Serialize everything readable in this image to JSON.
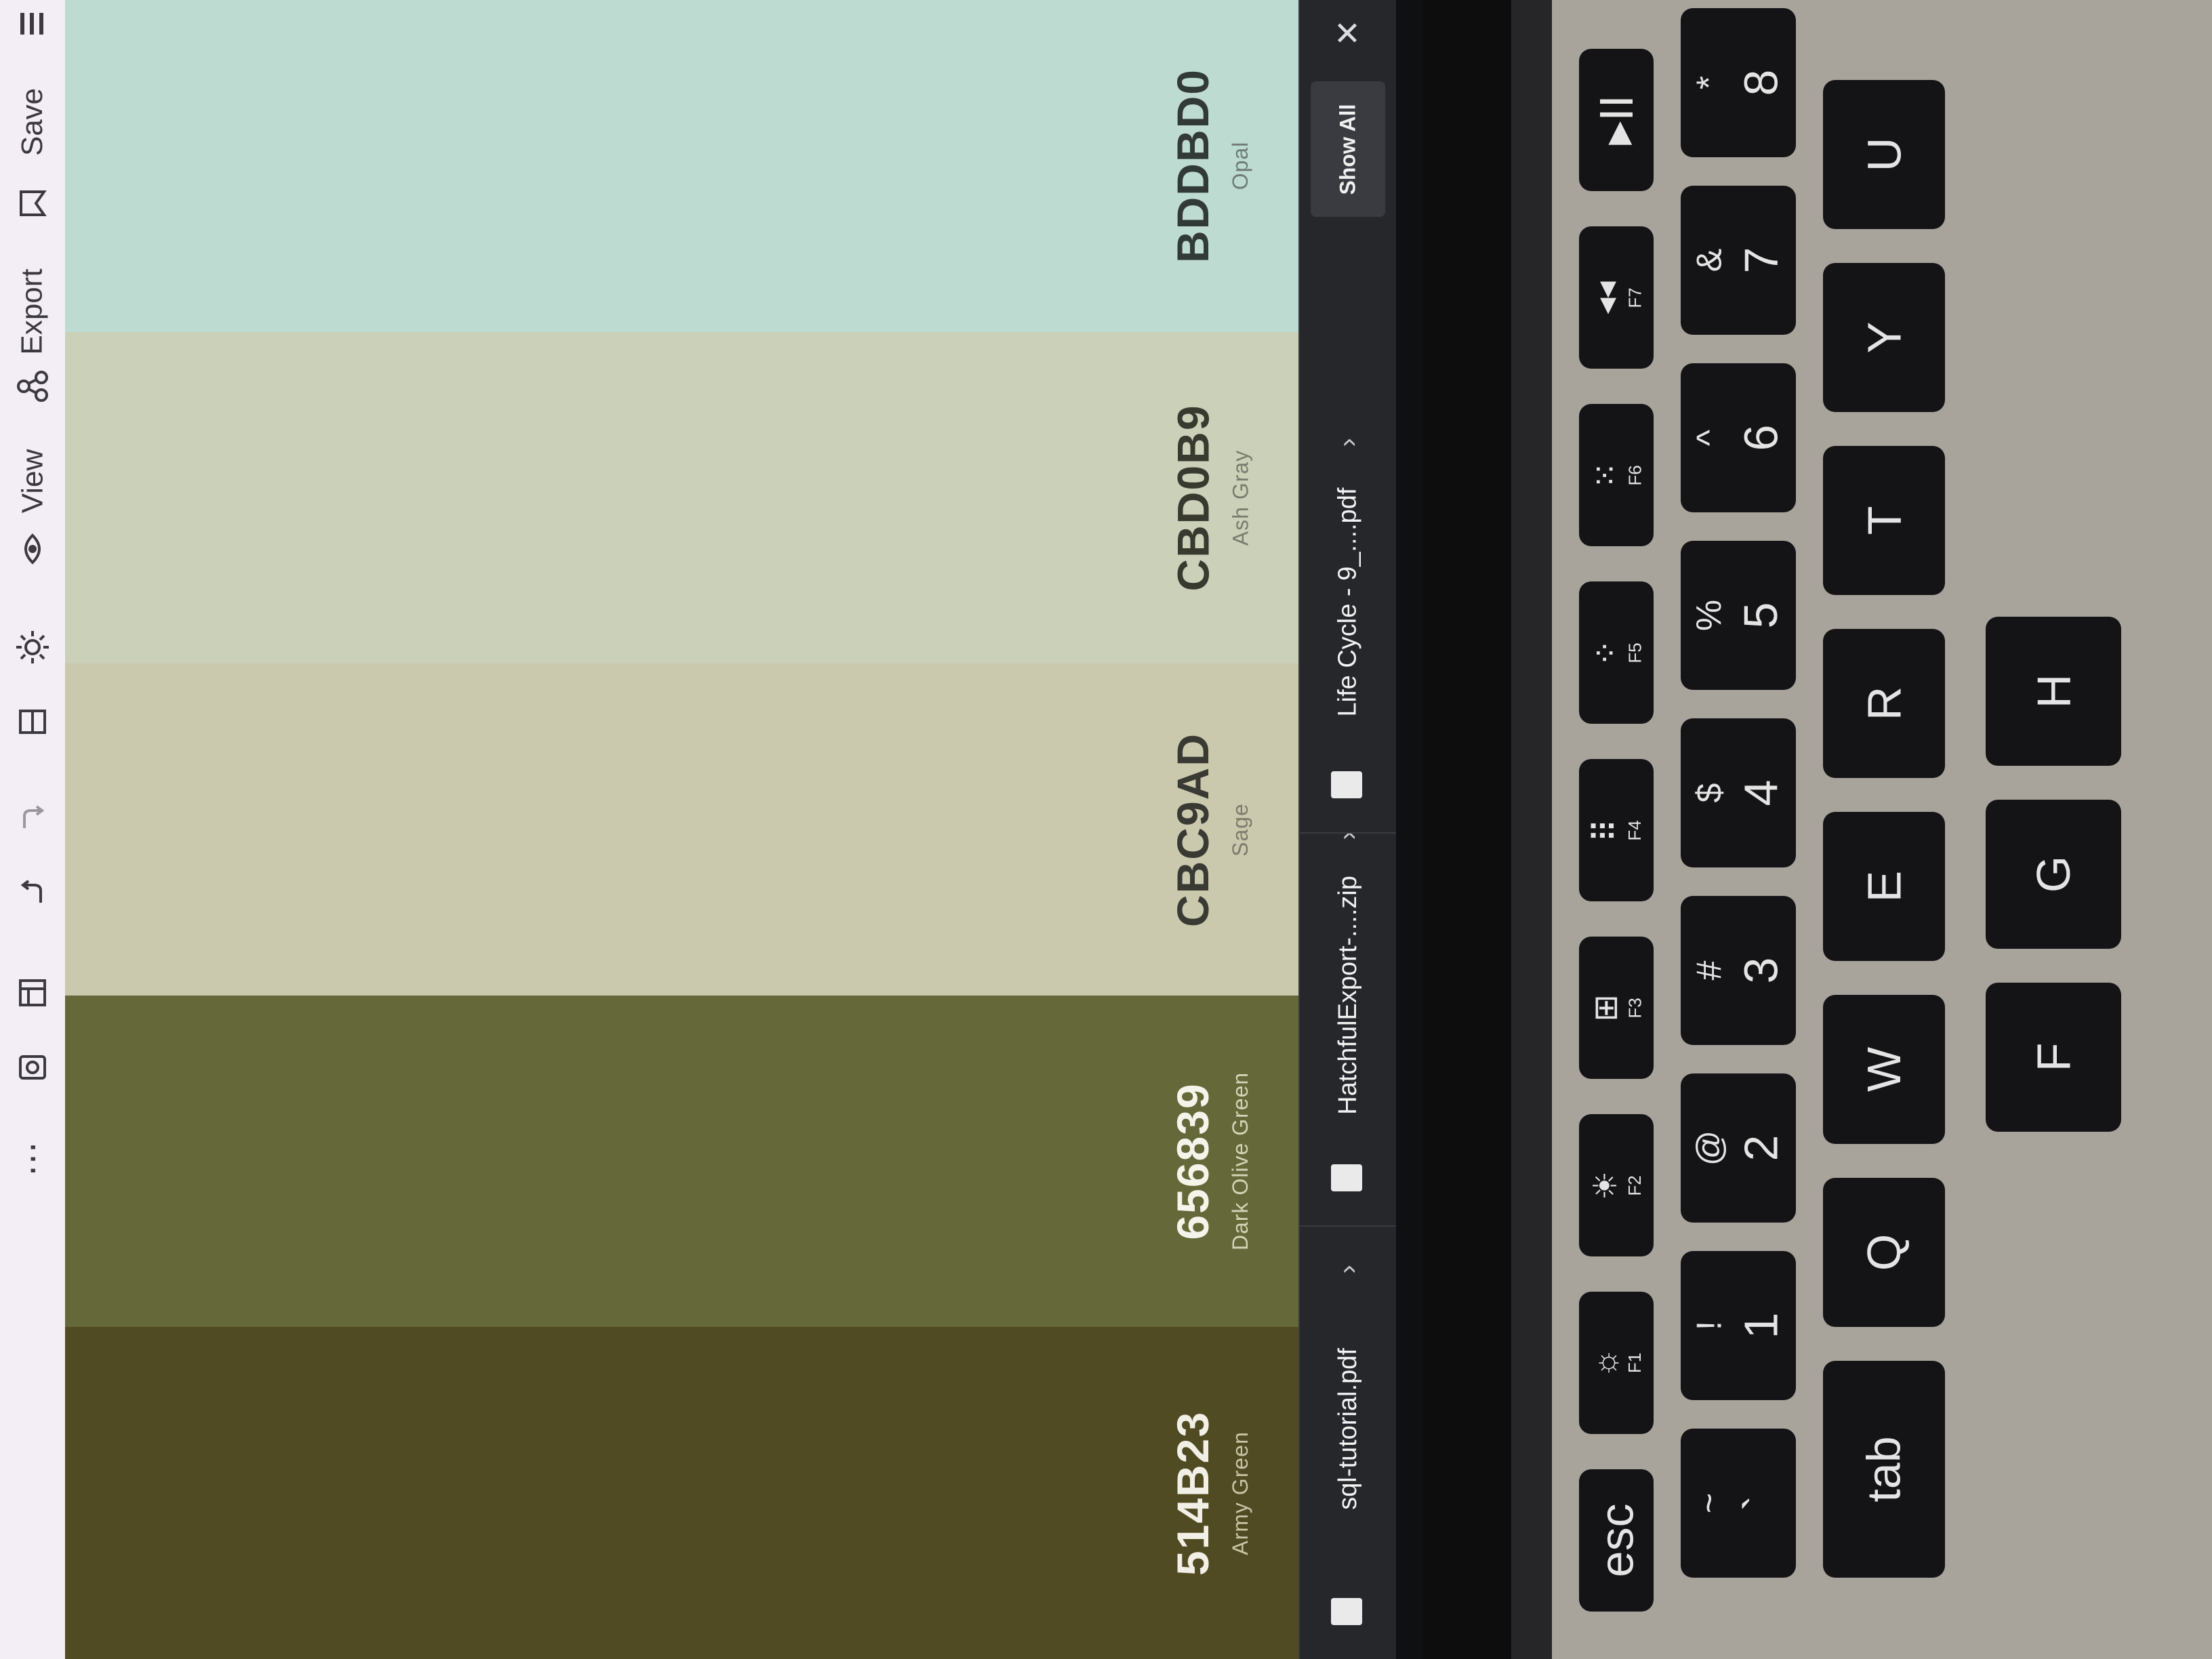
{
  "toolbar": {
    "more_icon": "⋯",
    "items": [
      {
        "name": "save",
        "label": "Save",
        "icon": "bookmark-icon"
      },
      {
        "name": "export",
        "label": "Export",
        "icon": "share-icon"
      },
      {
        "name": "view",
        "label": "View",
        "icon": "eye-icon"
      }
    ]
  },
  "palette": {
    "swatches": [
      {
        "hex": "514B23",
        "name": "Army Green",
        "color": "#514b23",
        "text_color": "#f2f0e6",
        "name_color": "#c8c4a6"
      },
      {
        "hex": "656839",
        "name": "Dark Olive Green",
        "color": "#656839",
        "text_color": "#f4f4ea",
        "name_color": "#d3d4b6"
      },
      {
        "hex": "CBC9AD",
        "name": "Sage",
        "color": "#cbc9ad",
        "text_color": "#3a3a34",
        "name_color": "#7d7b6c"
      },
      {
        "hex": "CBD0B9",
        "name": "Ash Gray",
        "color": "#cbd0b9",
        "text_color": "#38392f",
        "name_color": "#7a7d6e"
      },
      {
        "hex": "BDDBD0",
        "name": "Opal",
        "color": "#bddbd0",
        "text_color": "#323a38",
        "name_color": "#6f7c78"
      }
    ]
  },
  "downloads": {
    "items": [
      {
        "filename": "sql-tutorial.pdf"
      },
      {
        "filename": "HatchfulExport-....zip"
      },
      {
        "filename": "Life Cycle - 9_....pdf"
      }
    ],
    "show_all": "Show All",
    "close": "✕"
  },
  "keyboard": {
    "fn_row": [
      {
        "label": "esc",
        "fn": ""
      },
      {
        "label": "☼",
        "fn": "F1"
      },
      {
        "label": "☀",
        "fn": "F2"
      },
      {
        "label": "⊞",
        "fn": "F3"
      },
      {
        "label": "⠿",
        "fn": "F4"
      },
      {
        "label": "⁘",
        "fn": "F5"
      },
      {
        "label": "⁙",
        "fn": "F6"
      },
      {
        "label": "◂◂",
        "fn": "F7"
      },
      {
        "label": "▸II",
        "fn": ""
      }
    ],
    "number_row": [
      {
        "top": "~",
        "main": "`"
      },
      {
        "top": "!",
        "main": "1"
      },
      {
        "top": "@",
        "main": "2"
      },
      {
        "top": "#",
        "main": "3"
      },
      {
        "top": "$",
        "main": "4"
      },
      {
        "top": "%",
        "main": "5"
      },
      {
        "top": "^",
        "main": "6"
      },
      {
        "top": "&",
        "main": "7"
      },
      {
        "top": "*",
        "main": "8"
      }
    ],
    "letter_row": [
      {
        "main": "tab"
      },
      {
        "main": "Q"
      },
      {
        "main": "W"
      },
      {
        "main": "E"
      },
      {
        "main": "R"
      },
      {
        "main": "T"
      },
      {
        "main": "Y"
      },
      {
        "main": "U"
      }
    ],
    "home_row": [
      {
        "main": "F"
      },
      {
        "main": "G"
      },
      {
        "main": "H"
      }
    ]
  }
}
